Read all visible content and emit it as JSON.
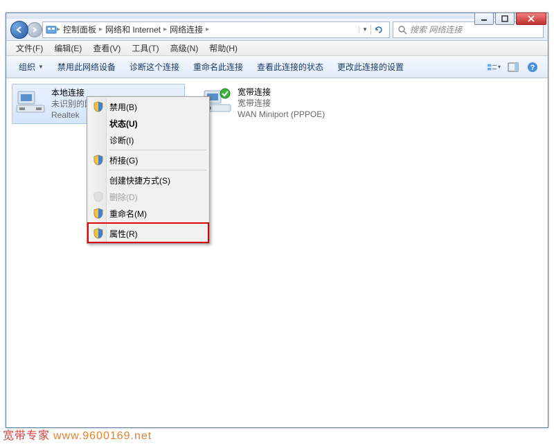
{
  "breadcrumb": {
    "items": [
      "控制面板",
      "网络和 Internet",
      "网络连接"
    ]
  },
  "search": {
    "placeholder": "搜索 网络连接"
  },
  "menubar": {
    "items": [
      "文件(F)",
      "编辑(E)",
      "查看(V)",
      "工具(T)",
      "高级(N)",
      "帮助(H)"
    ]
  },
  "toolbar": {
    "organize": "组织",
    "items": [
      "禁用此网络设备",
      "诊断这个连接",
      "重命名此连接",
      "查看此连接的状态",
      "更改此连接的设置"
    ]
  },
  "connections": [
    {
      "title": "本地连接",
      "sub1": "未识别的网络",
      "sub2": "Realtek",
      "selected": true,
      "status": "normal"
    },
    {
      "title": "宽带连接",
      "sub1": "宽带连接",
      "sub2": "WAN Miniport (PPPOE)",
      "selected": false,
      "status": "ok"
    }
  ],
  "contextmenu": {
    "items": [
      {
        "label": "禁用(B)",
        "icon": "shield",
        "type": "item"
      },
      {
        "label": "状态(U)",
        "icon": "",
        "type": "bold"
      },
      {
        "label": "诊断(I)",
        "icon": "",
        "type": "item"
      },
      {
        "type": "sep"
      },
      {
        "label": "桥接(G)",
        "icon": "shield",
        "type": "item"
      },
      {
        "type": "sep"
      },
      {
        "label": "创建快捷方式(S)",
        "icon": "",
        "type": "item"
      },
      {
        "label": "删除(D)",
        "icon": "shield-dis",
        "type": "disabled"
      },
      {
        "label": "重命名(M)",
        "icon": "shield",
        "type": "item"
      },
      {
        "type": "sep"
      },
      {
        "label": "属性(R)",
        "icon": "shield",
        "type": "item",
        "highlight": true
      }
    ]
  },
  "watermark": {
    "w1": "宽带专家",
    "w2": "www.9600169.net"
  }
}
